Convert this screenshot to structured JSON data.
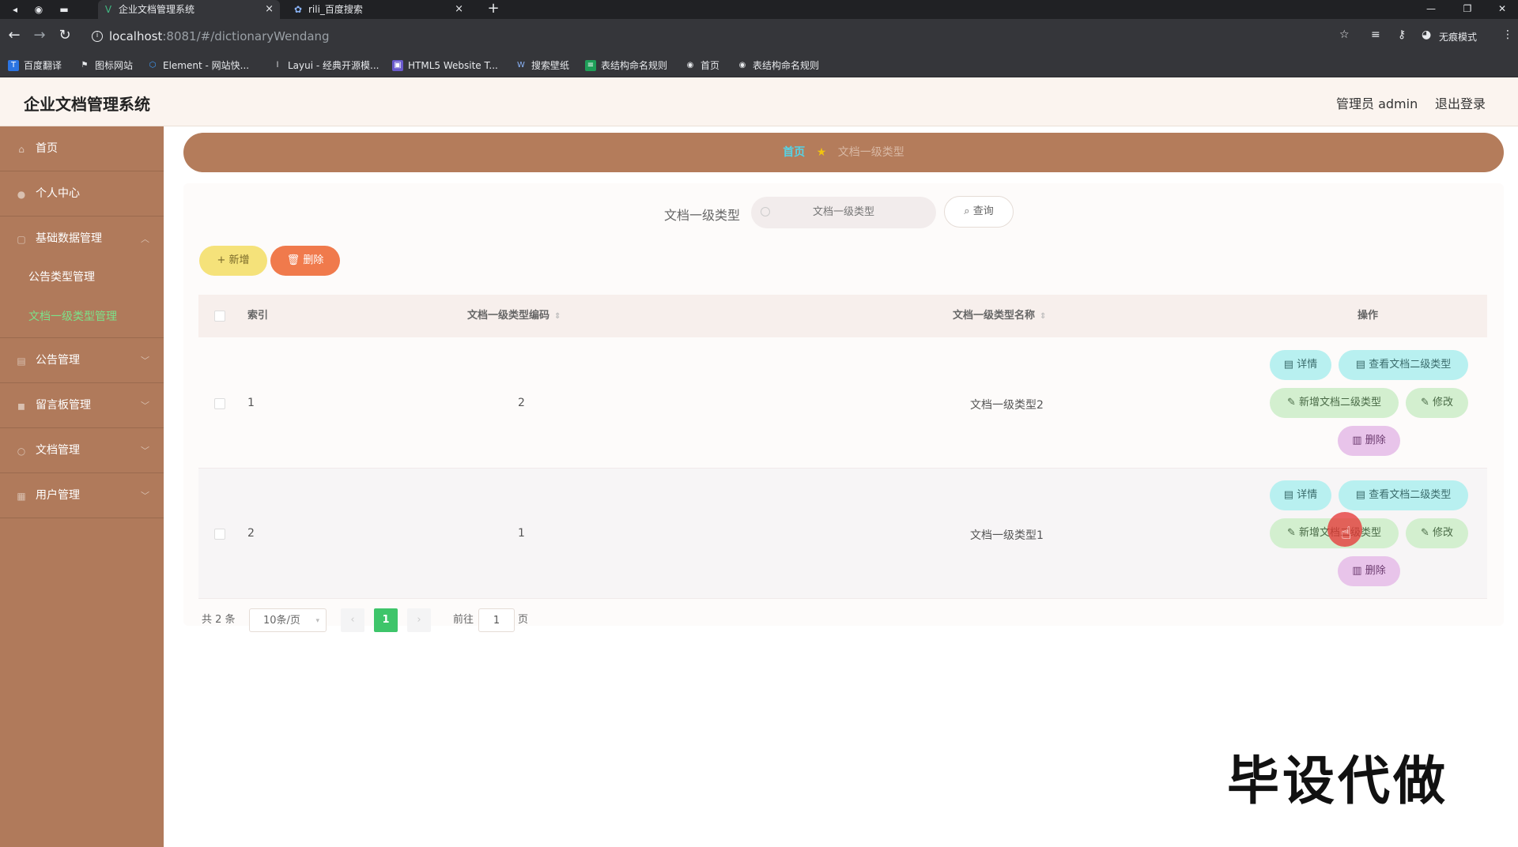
{
  "browser": {
    "tabs": [
      {
        "title": "企业文档管理系统",
        "active": true,
        "icon": "vue-logo-icon"
      },
      {
        "title": "rili_百度搜索",
        "active": false,
        "icon": "baidu-paw-icon"
      }
    ],
    "url_host": "localhost",
    "url_path": ":8081/#/dictionaryWendang",
    "incognito_label": "无痕模式",
    "bookmarks": [
      "百度翻译",
      "图标网站",
      "Element - 网站快...",
      "Layui - 经典开源模...",
      "HTML5 Website T...",
      "搜索壁纸",
      "表结构命名规则",
      "首页",
      "表结构命名规则"
    ]
  },
  "app": {
    "title": "企业文档管理系统",
    "user_label": "管理员 admin",
    "logout_label": "退出登录"
  },
  "sidebar": {
    "items": [
      {
        "label": "首页",
        "icon": "home-icon"
      },
      {
        "label": "个人中心",
        "icon": "user-icon"
      },
      {
        "label": "基础数据管理",
        "icon": "data-icon",
        "expanded": true,
        "children": [
          {
            "label": "公告类型管理",
            "active": false
          },
          {
            "label": "文档一级类型管理",
            "active": true
          }
        ]
      },
      {
        "label": "公告管理",
        "icon": "notice-icon"
      },
      {
        "label": "留言板管理",
        "icon": "message-icon"
      },
      {
        "label": "文档管理",
        "icon": "document-icon"
      },
      {
        "label": "用户管理",
        "icon": "users-icon"
      }
    ]
  },
  "breadcrumb": {
    "home": "首页",
    "current": "文档一级类型"
  },
  "search": {
    "label": "文档一级类型",
    "placeholder": "文档一级类型",
    "query_label": "查询"
  },
  "actions": {
    "add_label": "新增",
    "delete_label": "删除"
  },
  "table": {
    "headers": {
      "index": "索引",
      "code": "文档一级类型编码",
      "name": "文档一级类型名称",
      "ops": "操作"
    },
    "rows": [
      {
        "index": "1",
        "code": "2",
        "name": "文档一级类型2"
      },
      {
        "index": "2",
        "code": "1",
        "name": "文档一级类型1"
      }
    ],
    "op_labels": {
      "detail": "详情",
      "view_sub": "查看文档二级类型",
      "add_sub": "新增文档二级类型",
      "edit": "修改",
      "delete": "删除"
    }
  },
  "pagination": {
    "total_text": "共 2 条",
    "page_size": "10条/页",
    "current_page": "1",
    "goto_label": "前往",
    "goto_value": "1",
    "goto_unit": "页"
  },
  "watermark": "毕设代做",
  "colors": {
    "sidebar_bg": "#b07a5b",
    "breadcrumb_bg": "#b47c5b",
    "active_menu": "#7be28a",
    "add_btn": "#f5e27a",
    "delete_btn": "#f07a4c",
    "page_active": "#3ec56a"
  }
}
